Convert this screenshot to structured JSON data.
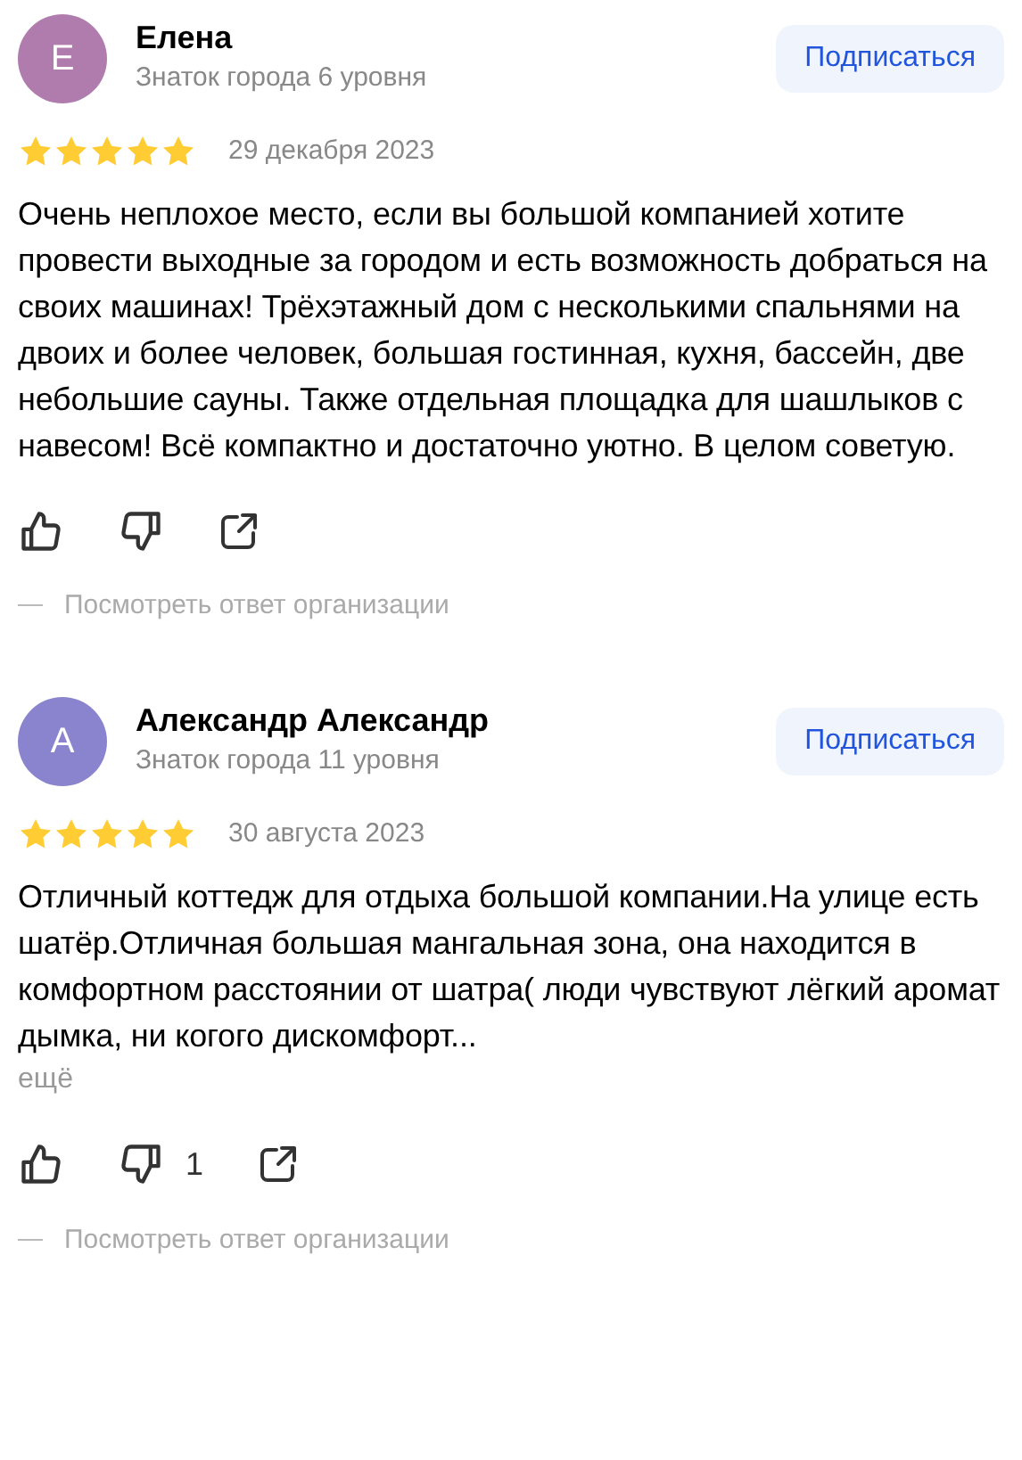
{
  "reviews": [
    {
      "initial": "Е",
      "color": "#b07cad",
      "name": "Елена",
      "badge": "Знаток города 6 уровня",
      "subscribe": "Подписаться",
      "stars": 5,
      "date": "29 декабря 2023",
      "text": "Очень неплохое место, если вы большой компанией хотите провести выходные за городом и есть возможность добраться на своих машинах! Трёхэтажный дом с несколькими спальнями на двоих и более человек, большая гостинная, кухня, бассейн, две небольшие сауны. Также отдельная площадка для шашлыков с навесом! Всё компактно и достаточно уютно. В целом советую.",
      "org_reply": "Посмотреть ответ организации"
    },
    {
      "initial": "А",
      "color": "#8a84cf",
      "name": "Александр Александр",
      "badge": "Знаток города 11 уровня",
      "subscribe": "Подписаться",
      "stars": 5,
      "date": "30 августа 2023",
      "text": "Отличный коттедж для отдыха большой компании.На улице есть шатёр.Отличная большая мангальная зона, она находится в комфортном расстоянии от шатра( люди чувствуют лёгкий аромат дымка, ни когого дискомфорт...",
      "more": "ещё",
      "dislikes": "1",
      "org_reply": "Посмотреть ответ организации"
    }
  ]
}
